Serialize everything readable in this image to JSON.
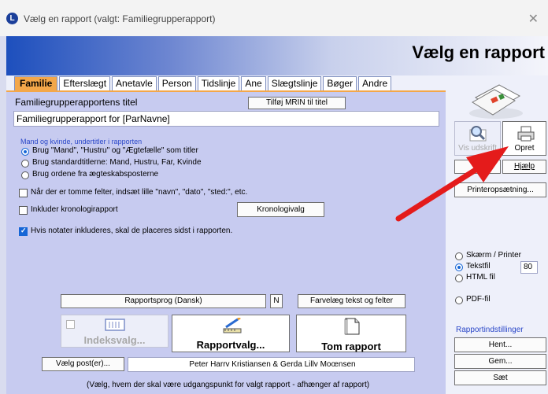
{
  "window": {
    "title": "Vælg en rapport (valgt: Familiegrupperapport)",
    "app_icon_letter": "L",
    "close_glyph": "✕"
  },
  "banner": {
    "heading": "Vælg en rapport"
  },
  "tabs": [
    "Familie",
    "Efterslægt",
    "Anetavle",
    "Person",
    "Tidslinje",
    "Ane",
    "Slægtslinje",
    "Bøger",
    "Andre"
  ],
  "form": {
    "title_label": "Familiegrupperapportens titel",
    "add_mrin_button": "Tilføj MRIN til titel",
    "title_value": "Familiegrupperapport for [ParNavne]",
    "group_title": "Mand og kvinde, undertitler i rapporten",
    "radio_options": [
      "Brug \"Mand\", \"Hustru\" og \"Ægtefælle\" som titler",
      "Brug standardtitlerne: Mand, Hustru, Far, Kvinde",
      "Brug ordene fra ægteskabsposterne"
    ],
    "empty_fields_label": "Når der er tomme felter, indsæt lille \"navn\", \"dato\", \"sted:\", etc.",
    "chronology_label": "Inkluder kronologirapport",
    "chronology_button": "Kronologivalg",
    "notes_label": "Hvis notater inkluderes, skal de placeres sidst i rapporten.",
    "language_button": "Rapportsprog (Dansk)",
    "n_button": "N",
    "color_button": "Farvelæg tekst og felter",
    "index_button": "Indeksvalg...",
    "report_options_button": "Rapportvalg...",
    "empty_report_button": "Tom rapport",
    "select_records_button": "Vælg post(er)...",
    "selected_people": "Peter Harrv Kristiansen & Gerda Lillv Moœnsen",
    "hint": "(Vælg, hvem der skal være udgangspunkt for valgt rapport - afhænger af rapport)"
  },
  "right": {
    "preview_label": "Vis udskrift",
    "create_label": "Opret",
    "help_button": "Hjælp",
    "printer_setup_button": "Printeropsætning...",
    "output_options": [
      "Skærm / Printer",
      "Tekstfil",
      "HTML fil"
    ],
    "text_width": "80",
    "pdf_option": "PDF-fil",
    "settings_title": "Rapportindstillinger",
    "get_button": "Hent...",
    "save_button": "Gem...",
    "set_button": "Sæt"
  },
  "colors": {
    "accent": "#f3a74a",
    "panel": "#c7cbf0",
    "arrow": "#e41b1b",
    "blue": "#1666d6"
  }
}
